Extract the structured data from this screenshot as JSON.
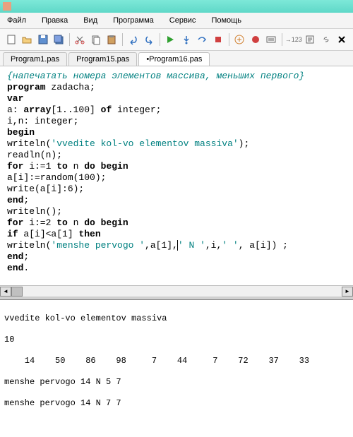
{
  "menu": {
    "file": "Файл",
    "edit": "Правка",
    "view": "Вид",
    "program": "Программа",
    "service": "Сервис",
    "help": "Помощь"
  },
  "tabs": {
    "t1": "Program1.pas",
    "t2": "Program15.pas",
    "t3": "•Program16.pas"
  },
  "code": {
    "l1": "{напечатать номера элементов массива, меньших первого}",
    "l2": "",
    "l3a": "program",
    "l3b": " zadacha;",
    "l4": "var",
    "l5a": "a: ",
    "l5b": "array",
    "l5c": "[1..100] ",
    "l5d": "of",
    "l5e": " integer;",
    "l6": "i,n: integer;",
    "l7": "begin",
    "l8a": "writeln(",
    "l8b": "'vvedite kol-vo elementov massiva'",
    "l8c": ");",
    "l9": "readln(n);",
    "l10a": "for",
    "l10b": " i:=1 ",
    "l10c": "to",
    "l10d": " n ",
    "l10e": "do begin",
    "l11": "a[i]:=random(100);",
    "l12": "write(a[i]:6);",
    "l13a": "end",
    "l13b": ";",
    "l14": "writeln();",
    "l15a": "for",
    "l15b": " i:=2 ",
    "l15c": "to",
    "l15d": " n ",
    "l15e": "do begin",
    "l16a": "if",
    "l16b": " a[i]<a[1] ",
    "l16c": "then",
    "l17a": "writeln(",
    "l17b": "'menshe pervogo '",
    "l17c": ",a[1],",
    "l17d": "' N '",
    "l17e": ",i,",
    "l17f": "' '",
    "l17g": ", a[i]) ;",
    "l18a": "end",
    "l18b": ";",
    "l19a": "end",
    "l19b": "."
  },
  "output": {
    "l1": "vvedite kol-vo elementov massiva",
    "l2": "10",
    "l3": "    14    50    86    98     7    44     7    72    37    33",
    "l4": "menshe pervogo 14 N 5 7",
    "l5": "menshe pervogo 14 N 7 7"
  }
}
